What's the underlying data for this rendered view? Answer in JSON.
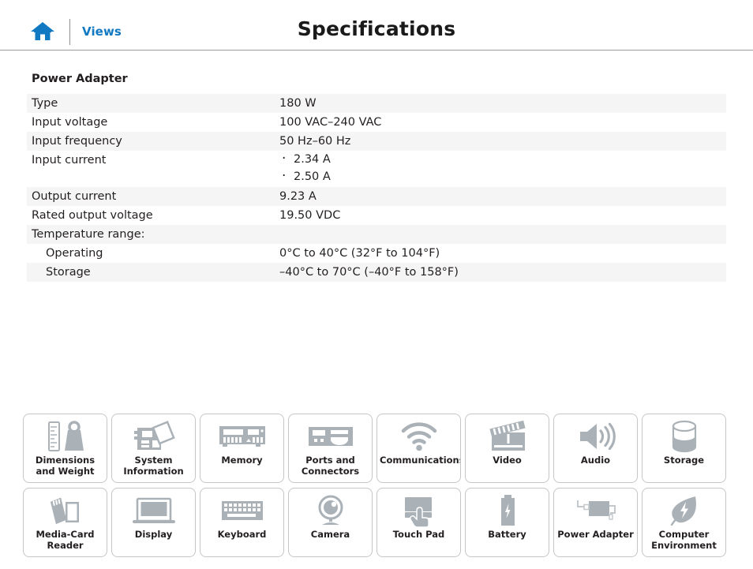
{
  "header": {
    "home_icon": "home-icon",
    "views_label": "Views",
    "title": "Specifications"
  },
  "spec": {
    "section_title": "Power Adapter",
    "rows": [
      {
        "label": "Type",
        "value": "180 W",
        "indent": false
      },
      {
        "label": "Input voltage",
        "value": "100 VAC–240 VAC",
        "indent": false
      },
      {
        "label": "Input frequency",
        "value": "50 Hz–60 Hz",
        "indent": false
      },
      {
        "label": "Input current",
        "values": [
          "2.34 A",
          "2.50 A"
        ],
        "indent": false
      },
      {
        "label": "Output current",
        "value": "9.23 A",
        "indent": false
      },
      {
        "label": "Rated output voltage",
        "value": "19.50 VDC",
        "indent": false
      },
      {
        "label": "Temperature range:",
        "value": "",
        "indent": false
      },
      {
        "label": "Operating",
        "value": "0°C to 40°C (32°F to 104°F)",
        "indent": true
      },
      {
        "label": "Storage",
        "value": "–40°C to 70°C (–40°F to 158°F)",
        "indent": true
      }
    ]
  },
  "tiles": [
    {
      "label": "Dimensions and Weight",
      "icon": "ruler-weight-icon"
    },
    {
      "label": "System Information",
      "icon": "motherboard-icon"
    },
    {
      "label": "Memory",
      "icon": "memory-module-icon"
    },
    {
      "label": "Ports and Connectors",
      "icon": "ports-icon"
    },
    {
      "label": "Communications",
      "icon": "wifi-icon"
    },
    {
      "label": "Video",
      "icon": "clapperboard-icon"
    },
    {
      "label": "Audio",
      "icon": "speaker-icon"
    },
    {
      "label": "Storage",
      "icon": "disk-cylinder-icon"
    },
    {
      "label": "Media-Card Reader",
      "icon": "media-card-icon"
    },
    {
      "label": "Display",
      "icon": "laptop-display-icon"
    },
    {
      "label": "Keyboard",
      "icon": "keyboard-icon"
    },
    {
      "label": "Camera",
      "icon": "webcam-icon"
    },
    {
      "label": "Touch Pad",
      "icon": "touchpad-hand-icon"
    },
    {
      "label": "Battery",
      "icon": "battery-icon"
    },
    {
      "label": "Power Adapter",
      "icon": "power-adapter-icon"
    },
    {
      "label": "Computer Environment",
      "icon": "leaf-bolt-icon"
    }
  ],
  "colors": {
    "link": "#1178c2",
    "home": "#1178c2",
    "icon_gray": "#aab2b8",
    "stripe": "#f5f5f5",
    "border": "#c6c6c6"
  }
}
